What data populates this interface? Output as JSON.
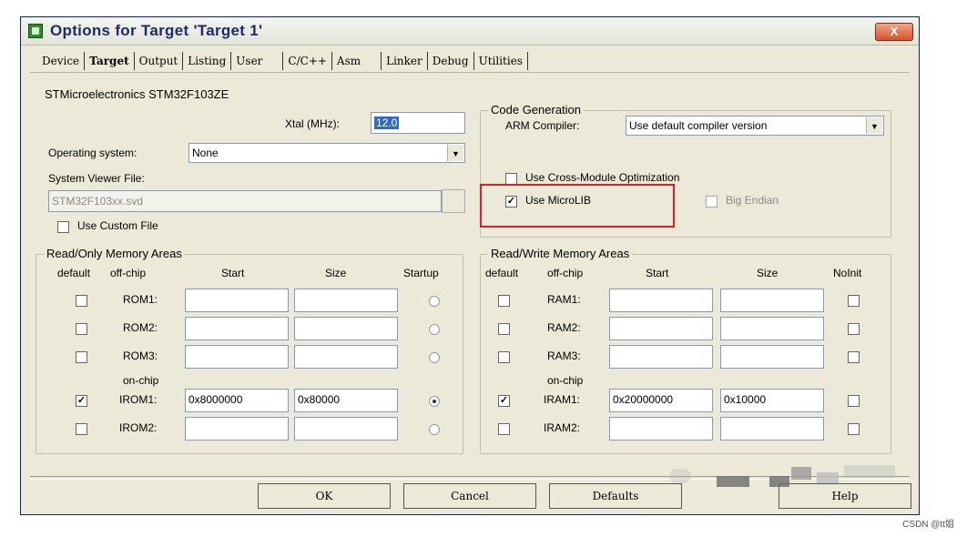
{
  "window": {
    "title": "Options for Target 'Target 1'",
    "close_label": "X"
  },
  "tabs": [
    "Device",
    "Target",
    "Output",
    "Listing",
    "User",
    "C/C++",
    "Asm",
    "Linker",
    "Debug",
    "Utilities"
  ],
  "selected_tab": "Target",
  "device_name": "STMicroelectronics STM32F103ZE",
  "xtal": {
    "label": "Xtal (MHz):",
    "value": "12.0"
  },
  "operating_system": {
    "label": "Operating system:",
    "value": "None"
  },
  "system_viewer": {
    "label": "System Viewer File:",
    "value": "STM32F103xx.svd",
    "custom_label": "Use Custom File"
  },
  "code_generation": {
    "legend": "Code Generation",
    "compiler_label": "ARM Compiler:",
    "compiler_value": "Use default compiler version",
    "cross_module": "Use Cross-Module Optimization",
    "microlib": "Use MicroLIB",
    "big_endian": "Big Endian"
  },
  "rom": {
    "legend": "Read/Only Memory Areas",
    "headers": [
      "default",
      "off-chip",
      "Start",
      "Size",
      "Startup"
    ],
    "on_chip_label": "on-chip",
    "rows": [
      {
        "name": "ROM1:",
        "start": "",
        "size": "",
        "checked": "",
        "startup": false
      },
      {
        "name": "ROM2:",
        "start": "",
        "size": "",
        "checked": "",
        "startup": false
      },
      {
        "name": "ROM3:",
        "start": "",
        "size": "",
        "checked": "",
        "startup": false
      },
      {
        "name": "IROM1:",
        "start": "0x8000000",
        "size": "0x80000",
        "checked": "✓",
        "startup": true
      },
      {
        "name": "IROM2:",
        "start": "",
        "size": "",
        "checked": "",
        "startup": false
      }
    ]
  },
  "ram": {
    "legend": "Read/Write Memory Areas",
    "headers": [
      "default",
      "off-chip",
      "Start",
      "Size",
      "NoInit"
    ],
    "on_chip_label": "on-chip",
    "rows": [
      {
        "name": "RAM1:",
        "start": "",
        "size": "",
        "checked": ""
      },
      {
        "name": "RAM2:",
        "start": "",
        "size": "",
        "checked": ""
      },
      {
        "name": "RAM3:",
        "start": "",
        "size": "",
        "checked": ""
      },
      {
        "name": "IRAM1:",
        "start": "0x20000000",
        "size": "0x10000",
        "checked": "✓"
      },
      {
        "name": "IRAM2:",
        "start": "",
        "size": "",
        "checked": ""
      }
    ]
  },
  "buttons": {
    "ok": "OK",
    "cancel": "Cancel",
    "defaults": "Defaults",
    "help": "Help"
  },
  "check_mark": "✓",
  "watermark": "CSDN @tt姐",
  "colors": {
    "highlight": "#e02020",
    "selection": "#316ac5"
  }
}
